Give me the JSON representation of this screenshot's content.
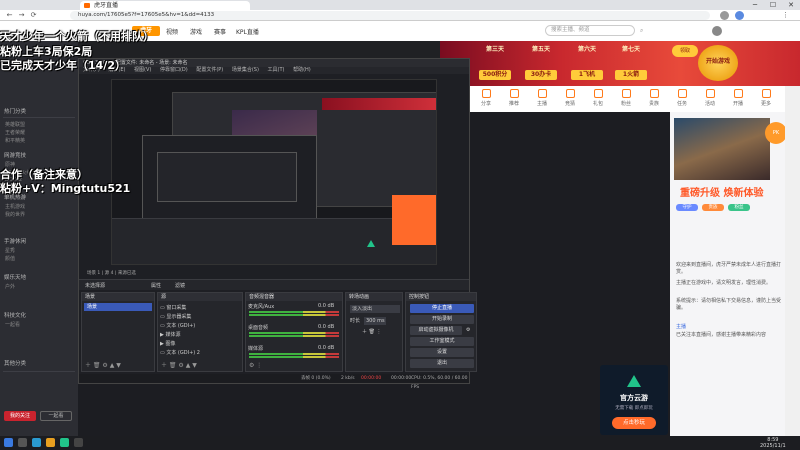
{
  "browser": {
    "tab_title": "虎牙直播",
    "url": "huya.com/17605e5?f=17605e5&hv=1&dd=4133",
    "controls": {
      "min": "─",
      "max": "☐",
      "close": "✕"
    }
  },
  "overlay": {
    "line1": "天才少年一个火箭（不用排队）",
    "line2": "粘粉上车3局保2局",
    "line3": "已完成天才少年（14/2）",
    "line4": "合作（备注来意）",
    "line5": "粘粉+V：Mingtutu521"
  },
  "site": {
    "logo": "虎牙",
    "nav": [
      "视频",
      "游戏",
      "赛事",
      "KPL直播"
    ],
    "search_placeholder": "搜索主播、频道"
  },
  "banner": {
    "days": [
      {
        "label": "第三天",
        "prize": "500积分"
      },
      {
        "label": "第五天",
        "prize": "30办卡"
      },
      {
        "label": "第六天",
        "prize": "1飞机"
      },
      {
        "label": "第七天",
        "prize": "1火箭"
      }
    ],
    "btn": "领取",
    "start_badge": "开始游戏"
  },
  "icon_row": [
    "分享",
    "推荐",
    "主播",
    "竞猜",
    "礼包",
    "粉丝",
    "贵族",
    "任务",
    "活动",
    "开播",
    "更多"
  ],
  "right_col": {
    "badge": "PK",
    "promo": "重磅升级 焕新体验",
    "texts": [
      "欢迎来到直播间，虎牙严禁未成年人进行直播打赏。",
      "主播正在游戏中，请文明发言，理性消费。",
      "系统提示：请勿相信私下交易信息，谨防上当受骗。"
    ],
    "chips": [
      "守护",
      "贵族",
      "粉丝"
    ],
    "user": "主播",
    "footer_text": "已关注本直播间，感谢主播带来精彩内容"
  },
  "gift_card": {
    "title": "官方云游",
    "sub": "无需下载 即点即玩",
    "btn": "点击秒玩"
  },
  "left_panel": {
    "heads": [
      "热门分类",
      "网游竞技",
      "单机热游",
      "手游休闲",
      "娱乐天地",
      "科技文化",
      "其他分类"
    ],
    "rows": [
      "英雄联盟",
      "王者荣耀",
      "和平精英",
      "原神",
      "CF穿越火线",
      "DOTA2",
      "主机游戏",
      "我的世界",
      "星秀",
      "颜值",
      "户外",
      "一起看"
    ],
    "btn_primary": "我的关注",
    "btn_secondary": "一起看"
  },
  "obs": {
    "title": "OBS 32.0.1 - 配置文件: 未命名 - 场景: 未命名",
    "menu": [
      "文件(F)",
      "编辑(E)",
      "视图(V)",
      "停靠窗口(D)",
      "配置文件(P)",
      "场景集合(S)",
      "工具(T)",
      "帮助(H)"
    ],
    "scene_info": "场景 1  |  源 4  |  来源已选",
    "toolbar": {
      "properties": "属性",
      "filters": "滤镜"
    },
    "scenes": {
      "title": "场景",
      "items": [
        "场景"
      ]
    },
    "sources": {
      "title": "源",
      "items": [
        "窗口采集",
        "显示器采集",
        "文本 (GDI+)",
        "媒体源",
        "图像",
        "文本 (GDI+) 2"
      ]
    },
    "mixer": {
      "title": "音频混音器",
      "tracks": [
        {
          "name": "麦克风/Aux",
          "db": "0.0 dB",
          "level": 0.6
        },
        {
          "name": "桌面音频",
          "db": "0.0 dB",
          "level": 0.45
        },
        {
          "name": "媒体源",
          "db": "0.0 dB",
          "level": 0.3
        }
      ]
    },
    "transitions": {
      "title": "转场动画",
      "select": "淡入淡出",
      "duration_label": "时长",
      "duration": "300 ms"
    },
    "controls": {
      "title": "控制按钮",
      "buttons": [
        "停止直播",
        "开始录制",
        "启动虚拟摄像机",
        "工作室模式",
        "设置",
        "退出"
      ]
    },
    "status": {
      "dropped": "丢帧 0 (0.0%)",
      "bitrate": "2 kb/s",
      "live": "00:00:00",
      "rec": "00:00:00",
      "cpu": "CPU: 0.5%,  60.00 / 60.00 FPS"
    }
  },
  "taskbar": {
    "time": "8:59",
    "date": "2025/11/1"
  }
}
